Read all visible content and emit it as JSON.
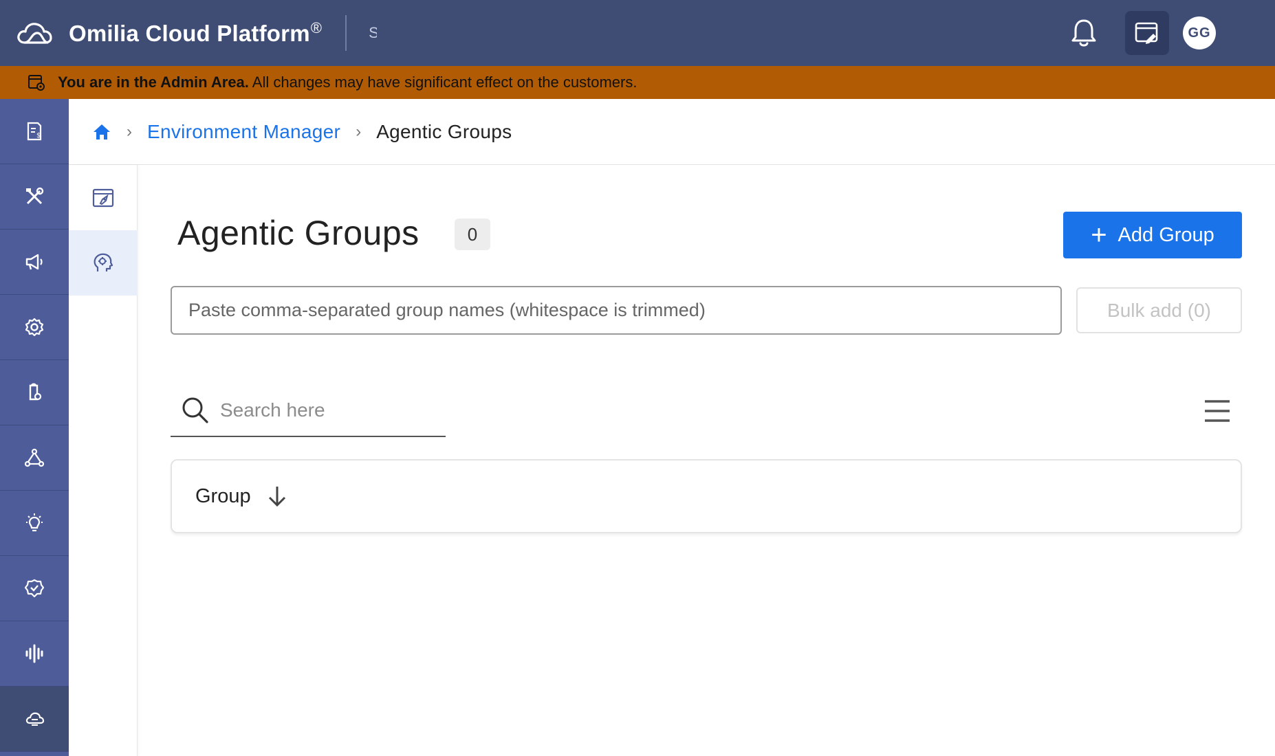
{
  "header": {
    "title": "Omilia Cloud Platform",
    "registered_mark": "®",
    "environment_label": "S",
    "avatar_initials": "GG",
    "icons": [
      "cloud-logo-icon",
      "bell-icon",
      "admin-area-icon"
    ],
    "colors": {
      "header_bg": "#3f4d75",
      "banner_bg": "#b15c05",
      "rail_bg": "#4e5d99",
      "accent": "#1a73e8"
    }
  },
  "banner": {
    "bold_text": "You are in the Admin Area.",
    "text": " All changes may have significant effect on the customers."
  },
  "rail": {
    "items": [
      {
        "icon": "invoice-icon"
      },
      {
        "icon": "tools-icon"
      },
      {
        "icon": "megaphone-icon"
      },
      {
        "icon": "gear-icon"
      },
      {
        "icon": "clipboard-icon"
      },
      {
        "icon": "network-nodes-icon"
      },
      {
        "icon": "lightbulb-icon"
      },
      {
        "icon": "badge-check-icon"
      },
      {
        "icon": "audio-wave-icon"
      },
      {
        "icon": "cloud-environment-icon",
        "active": true
      }
    ]
  },
  "subrail": {
    "items": [
      {
        "icon": "rocket-deploy-icon"
      },
      {
        "icon": "agentic-head-icon",
        "active": true
      }
    ]
  },
  "breadcrumb": {
    "link": "Environment Manager",
    "current": "Agentic Groups"
  },
  "main": {
    "title": "Agentic Groups",
    "count": "0",
    "add_button_label": "Add Group",
    "bulk_placeholder": "Paste comma-separated group names (whitespace is trimmed)",
    "bulk_button_label": "Bulk add (0)",
    "search_placeholder": "Search here",
    "table": {
      "columns": [
        "Group"
      ],
      "sort": "descending",
      "rows": []
    }
  }
}
